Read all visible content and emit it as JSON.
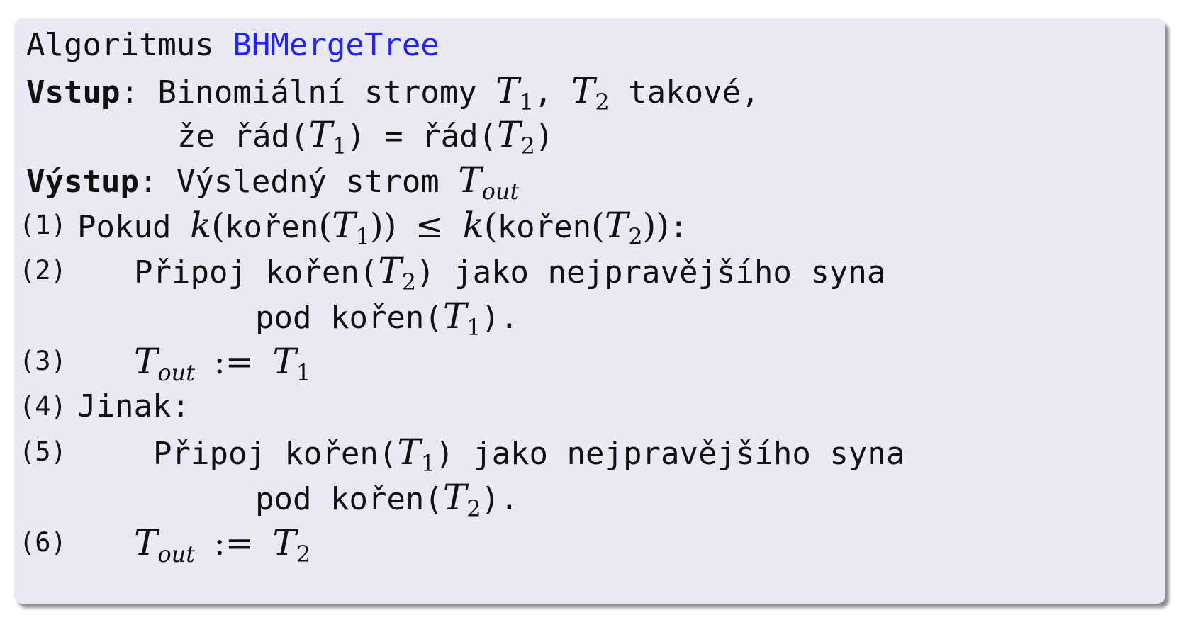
{
  "algorithm": {
    "label": "Algoritmus",
    "name": "BHMergeTree"
  },
  "input": {
    "label": "Vstup",
    "text_a": ": Binomiální stromy ",
    "text_b": ", ",
    "text_c": " takové,",
    "cont_a": "že řád(",
    "cont_b": ") = řád(",
    "cont_c": ")"
  },
  "output": {
    "label": "Výstup",
    "text": ": Výsledný strom "
  },
  "symbols": {
    "T": "T",
    "one": "1",
    "two": "2",
    "out": "out",
    "k": "k",
    "leq": "≤",
    "assign": ":=",
    "lparen": "(",
    "rparen": ")",
    "colon": ":"
  },
  "steps": [
    {
      "num": "(1)",
      "kw": "Pokud",
      "root_word": "kořen"
    },
    {
      "num": "(2)",
      "text_a": "Připoj kořen(",
      "text_b": ") jako nejpravějšího syna",
      "cont_a": "pod kořen(",
      "cont_b": ")."
    },
    {
      "num": "(3)"
    },
    {
      "num": "(4)",
      "text": "Jinak:"
    },
    {
      "num": "(5)",
      "text_a": "Připoj kořen(",
      "text_b": ") jako nejpravějšího syna",
      "cont_a": "pod kořen(",
      "cont_b": ")."
    },
    {
      "num": "(6)"
    }
  ]
}
